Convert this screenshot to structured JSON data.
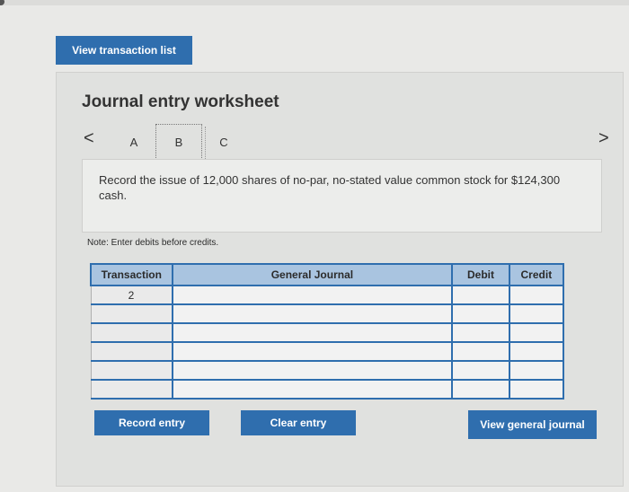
{
  "top_buttons": {
    "view_transaction_list": "View transaction list"
  },
  "worksheet": {
    "title": "Journal entry worksheet",
    "nav": {
      "prev": "<",
      "next": ">"
    },
    "tabs": [
      "A",
      "B",
      "C"
    ],
    "selected_tab": "B",
    "question": "Record the issue of 12,000 shares of no-par, no-stated value common stock for $124,300 cash.",
    "note": "Note: Enter debits before credits."
  },
  "journal_table": {
    "headers": {
      "transaction": "Transaction",
      "general_journal": "General Journal",
      "debit": "Debit",
      "credit": "Credit"
    },
    "rows": [
      {
        "transaction": "2"
      },
      {
        "transaction": ""
      },
      {
        "transaction": ""
      },
      {
        "transaction": ""
      },
      {
        "transaction": ""
      },
      {
        "transaction": ""
      }
    ]
  },
  "actions": {
    "record_entry": "Record entry",
    "clear_entry": "Clear entry",
    "view_general_journal": "View general journal"
  },
  "colors": {
    "primary_button": "#2f6eae",
    "table_header": "#a9c4e0"
  }
}
